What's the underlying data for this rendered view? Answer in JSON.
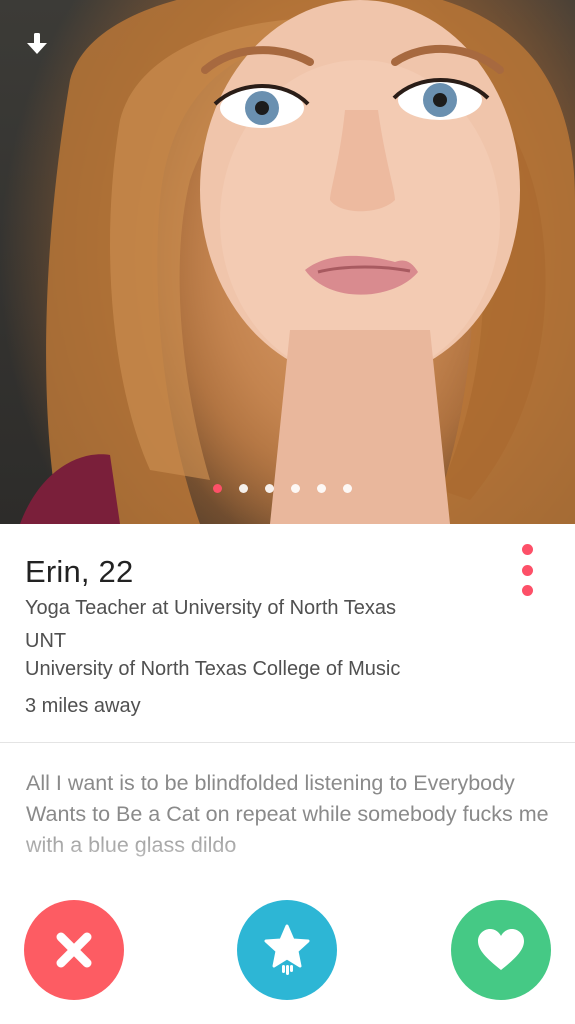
{
  "profile": {
    "name_age": "Erin, 22",
    "job": "Yoga Teacher at University of North Texas",
    "school_short": "UNT",
    "school_full": "University of North Texas College of Music",
    "distance": "3 miles away",
    "bio": "All I want is to be blindfolded listening to Everybody Wants to Be a Cat on repeat while somebody fucks me with a blue glass dildo"
  },
  "photo": {
    "count": 6,
    "active_index": 0
  },
  "icons": {
    "download": "download-arrow-icon",
    "more": "vertical-dots-icon",
    "nope": "x-icon",
    "superlike": "star-icon",
    "like": "heart-icon"
  },
  "colors": {
    "accent": "#fd5068",
    "nope": "#fd5c63",
    "superlike": "#2db6d5",
    "like": "#45c985"
  }
}
